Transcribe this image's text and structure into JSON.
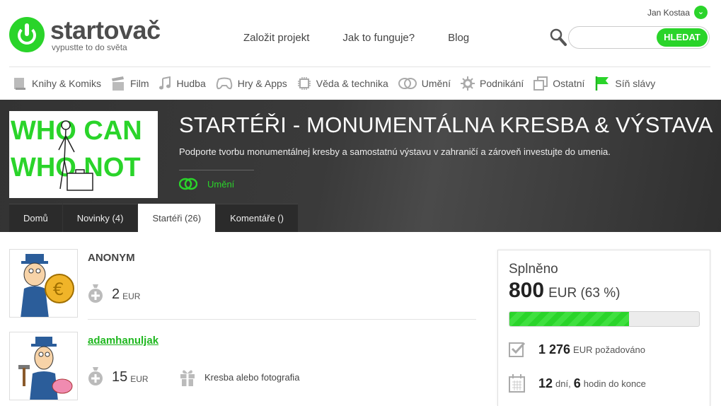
{
  "header": {
    "logo_name": "startovač",
    "logo_tagline": "vypustte to do světa",
    "user_name": "Jan Kostaa",
    "nav": [
      "Založit projekt",
      "Jak to funguje?",
      "Blog"
    ],
    "search_placeholder": "",
    "search_button": "HLEDAT"
  },
  "categories": [
    {
      "label": "Knihy & Komiks",
      "icon": "book-icon"
    },
    {
      "label": "Film",
      "icon": "film-icon"
    },
    {
      "label": "Hudba",
      "icon": "music-icon"
    },
    {
      "label": "Hry & Apps",
      "icon": "gamepad-icon"
    },
    {
      "label": "Věda & technika",
      "icon": "chip-icon"
    },
    {
      "label": "Umění",
      "icon": "theater-masks-icon"
    },
    {
      "label": "Podnikání",
      "icon": "gear-icon"
    },
    {
      "label": "Ostatní",
      "icon": "windows-icon"
    },
    {
      "label": "Síň slávy",
      "icon": "flag-icon"
    }
  ],
  "project": {
    "title": "STARTÉŘI - MONUMENTÁLNA KRESBA & VÝSTAVA",
    "description": "Podporte tvorbu monumentálnej kresby a samostatnú výstavu v zahraničí a zároveň investujte do umenia.",
    "category": "Umění",
    "image_text": [
      "WHO CAN",
      "WHO NOT"
    ]
  },
  "tabs": [
    {
      "label": "Domů",
      "active": false
    },
    {
      "label": "Novinky (4)",
      "active": false
    },
    {
      "label": "Startéři (26)",
      "active": true
    },
    {
      "label": "Komentáře ()",
      "active": false
    }
  ],
  "backers": [
    {
      "name": "ANONYM",
      "amount": "2",
      "currency": "EUR",
      "reward": ""
    },
    {
      "name": "adamhanuljak",
      "amount": "15",
      "currency": "EUR",
      "reward": "Kresba alebo fotografia"
    }
  ],
  "stats": {
    "label": "Splněno",
    "amount": "800",
    "amount_rest": "EUR (63 %)",
    "progress_fraction": 0.63,
    "goal_value": "1 276",
    "goal_text": "EUR požadováno",
    "days": "12",
    "days_text": "dní,",
    "hours": "6",
    "hours_text": "hodin do konce"
  },
  "colors": {
    "accent": "#2ad42a",
    "banner": "#353535"
  }
}
